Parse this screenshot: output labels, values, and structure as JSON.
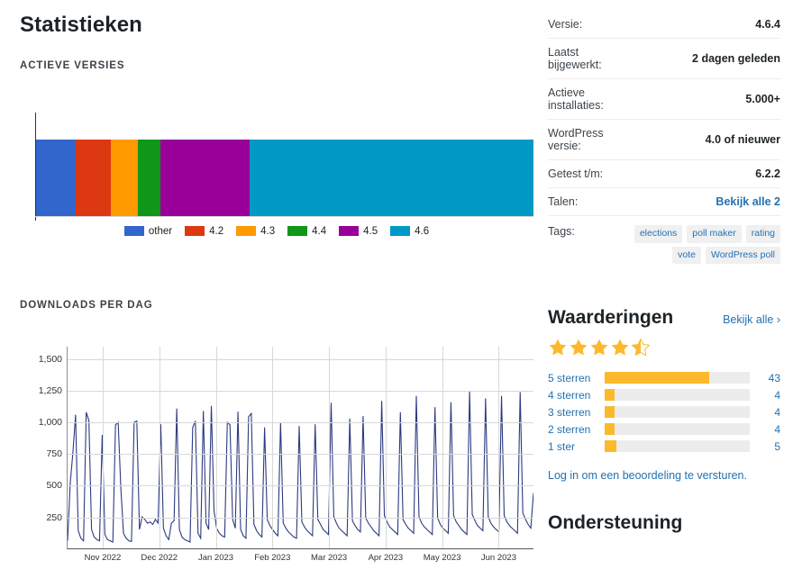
{
  "page_title": "Statistieken",
  "sections": {
    "active_versions_heading": "ACTIEVE VERSIES",
    "downloads_heading": "DOWNLOADS PER DAG"
  },
  "meta": {
    "rows": [
      {
        "key": "Versie:",
        "value": "4.6.4",
        "type": "text"
      },
      {
        "key": "Laatst bijgewerkt:",
        "value": "2 dagen geleden",
        "type": "text"
      },
      {
        "key": "Actieve installaties:",
        "value": "5.000+",
        "type": "text"
      },
      {
        "key": "WordPress versie:",
        "value": "4.0 of nieuwer",
        "type": "text"
      },
      {
        "key": "Getest t/m:",
        "value": "6.2.2",
        "type": "text"
      },
      {
        "key": "Talen:",
        "value": "Bekijk alle 2",
        "type": "link"
      }
    ],
    "tags_label": "Tags:",
    "tags": [
      "elections",
      "poll maker",
      "rating",
      "vote",
      "WordPress poll"
    ]
  },
  "ratings": {
    "title": "Waarderingen",
    "view_all": "Bekijk alle",
    "view_all_icon": "chevron-right-icon",
    "stars_filled": 4,
    "stars_half": 1,
    "stars_total": 5,
    "star_color": "#fcb92c",
    "breakdown": [
      {
        "label": "5 sterren",
        "count": 43,
        "percent": 72
      },
      {
        "label": "4 sterren",
        "count": 4,
        "percent": 6.7
      },
      {
        "label": "3 sterren",
        "count": 4,
        "percent": 6.7
      },
      {
        "label": "2 sterren",
        "count": 4,
        "percent": 6.7
      },
      {
        "label": "1 ster",
        "count": 5,
        "percent": 8.3
      }
    ],
    "login_note": "Log in om een beoordeling te versturen."
  },
  "support": {
    "title": "Ondersteuning"
  },
  "chart_data": [
    {
      "type": "bar",
      "subtype": "stacked-horizontal-100",
      "title": "ACTIEVE VERSIES",
      "categories": [
        "other",
        "4.2",
        "4.3",
        "4.4",
        "4.5",
        "4.6"
      ],
      "values": [
        8,
        7,
        5.5,
        4.5,
        18,
        57
      ],
      "colors": [
        "#3366cc",
        "#dc3912",
        "#ff9900",
        "#109618",
        "#990099",
        "#0099c6"
      ],
      "legend_position": "bottom",
      "xlabel": "",
      "ylabel": "",
      "grid": false
    },
    {
      "type": "line",
      "title": "DOWNLOADS PER DAG",
      "xlabel": "",
      "ylabel": "",
      "ylim": [
        0,
        1600
      ],
      "yticks": [
        250,
        500,
        750,
        1000,
        1250,
        1500
      ],
      "ytick_labels": [
        "250",
        "500",
        "750",
        "1,000",
        "1,250",
        "1,500"
      ],
      "xtick_labels": [
        "Nov 2022",
        "Dec 2022",
        "Jan 2023",
        "Feb 2023",
        "Mar 2023",
        "Apr 2023",
        "May 2023",
        "Jun 2023"
      ],
      "grid": true,
      "line_color": "#2b3a80",
      "series": [
        {
          "name": "Downloads",
          "values": [
            60,
            520,
            760,
            1060,
            140,
            80,
            60,
            1080,
            1015,
            150,
            90,
            70,
            60,
            900,
            110,
            70,
            60,
            50,
            980,
            1000,
            480,
            120,
            80,
            60,
            55,
            1000,
            1010,
            150,
            250,
            230,
            200,
            210,
            190,
            230,
            200,
            985,
            160,
            100,
            70,
            200,
            220,
            1110,
            150,
            90,
            70,
            60,
            50,
            960,
            1010,
            120,
            80,
            1090,
            200,
            150,
            1130,
            300,
            160,
            120,
            100,
            90,
            1000,
            980,
            230,
            160,
            1085,
            150,
            100,
            80,
            1045,
            1070,
            190,
            140,
            110,
            90,
            960,
            230,
            180,
            150,
            120,
            100,
            1000,
            200,
            160,
            130,
            110,
            90,
            80,
            970,
            210,
            170,
            140,
            120,
            100,
            985,
            230,
            190,
            150,
            130,
            110,
            1155,
            250,
            200,
            160,
            140,
            120,
            100,
            1030,
            220,
            180,
            150,
            130,
            1050,
            240,
            200,
            170,
            140,
            120,
            100,
            1170,
            260,
            210,
            170,
            150,
            130,
            110,
            1080,
            230,
            190,
            160,
            140,
            120,
            1210,
            250,
            200,
            170,
            150,
            130,
            110,
            1120,
            240,
            190,
            160,
            140,
            120,
            1160,
            260,
            210,
            180,
            150,
            130,
            110,
            1250,
            270,
            220,
            180,
            160,
            140,
            1190,
            250,
            200,
            170,
            150,
            130,
            1210,
            260,
            210,
            180,
            160,
            140,
            120,
            1240,
            280,
            230,
            190,
            160,
            440
          ]
        }
      ]
    }
  ]
}
